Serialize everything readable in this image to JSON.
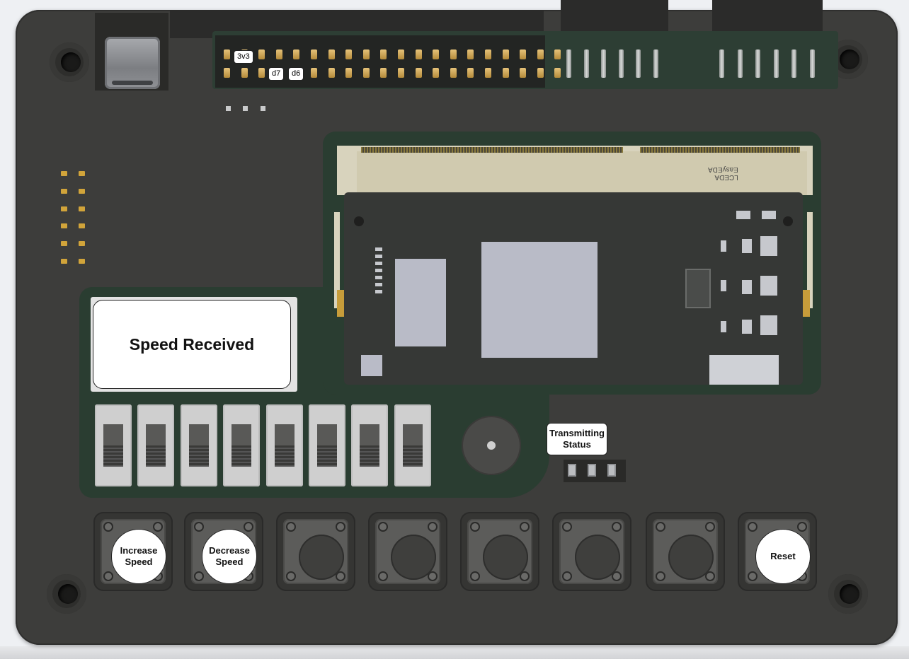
{
  "gpio": {
    "labels": {
      "pin_3v3": "3v3",
      "pin_d7": "d7",
      "pin_d6": "d6"
    }
  },
  "module": {
    "silkscreen_line1": "LCEDA",
    "silkscreen_line2": "EasyEDA"
  },
  "display": {
    "text": "Speed Received"
  },
  "status": {
    "label": "Transmitting Status"
  },
  "buttons": {
    "increase_speed": "Increase Speed",
    "decrease_speed": "Decrease Speed",
    "reset": "Reset"
  },
  "dip_switch_count": 8,
  "colors": {
    "enclosure": "#3d3d3b",
    "pcb": "#2a3d31",
    "label_background": "#ffffff",
    "header_pin": "#d1a43a"
  }
}
